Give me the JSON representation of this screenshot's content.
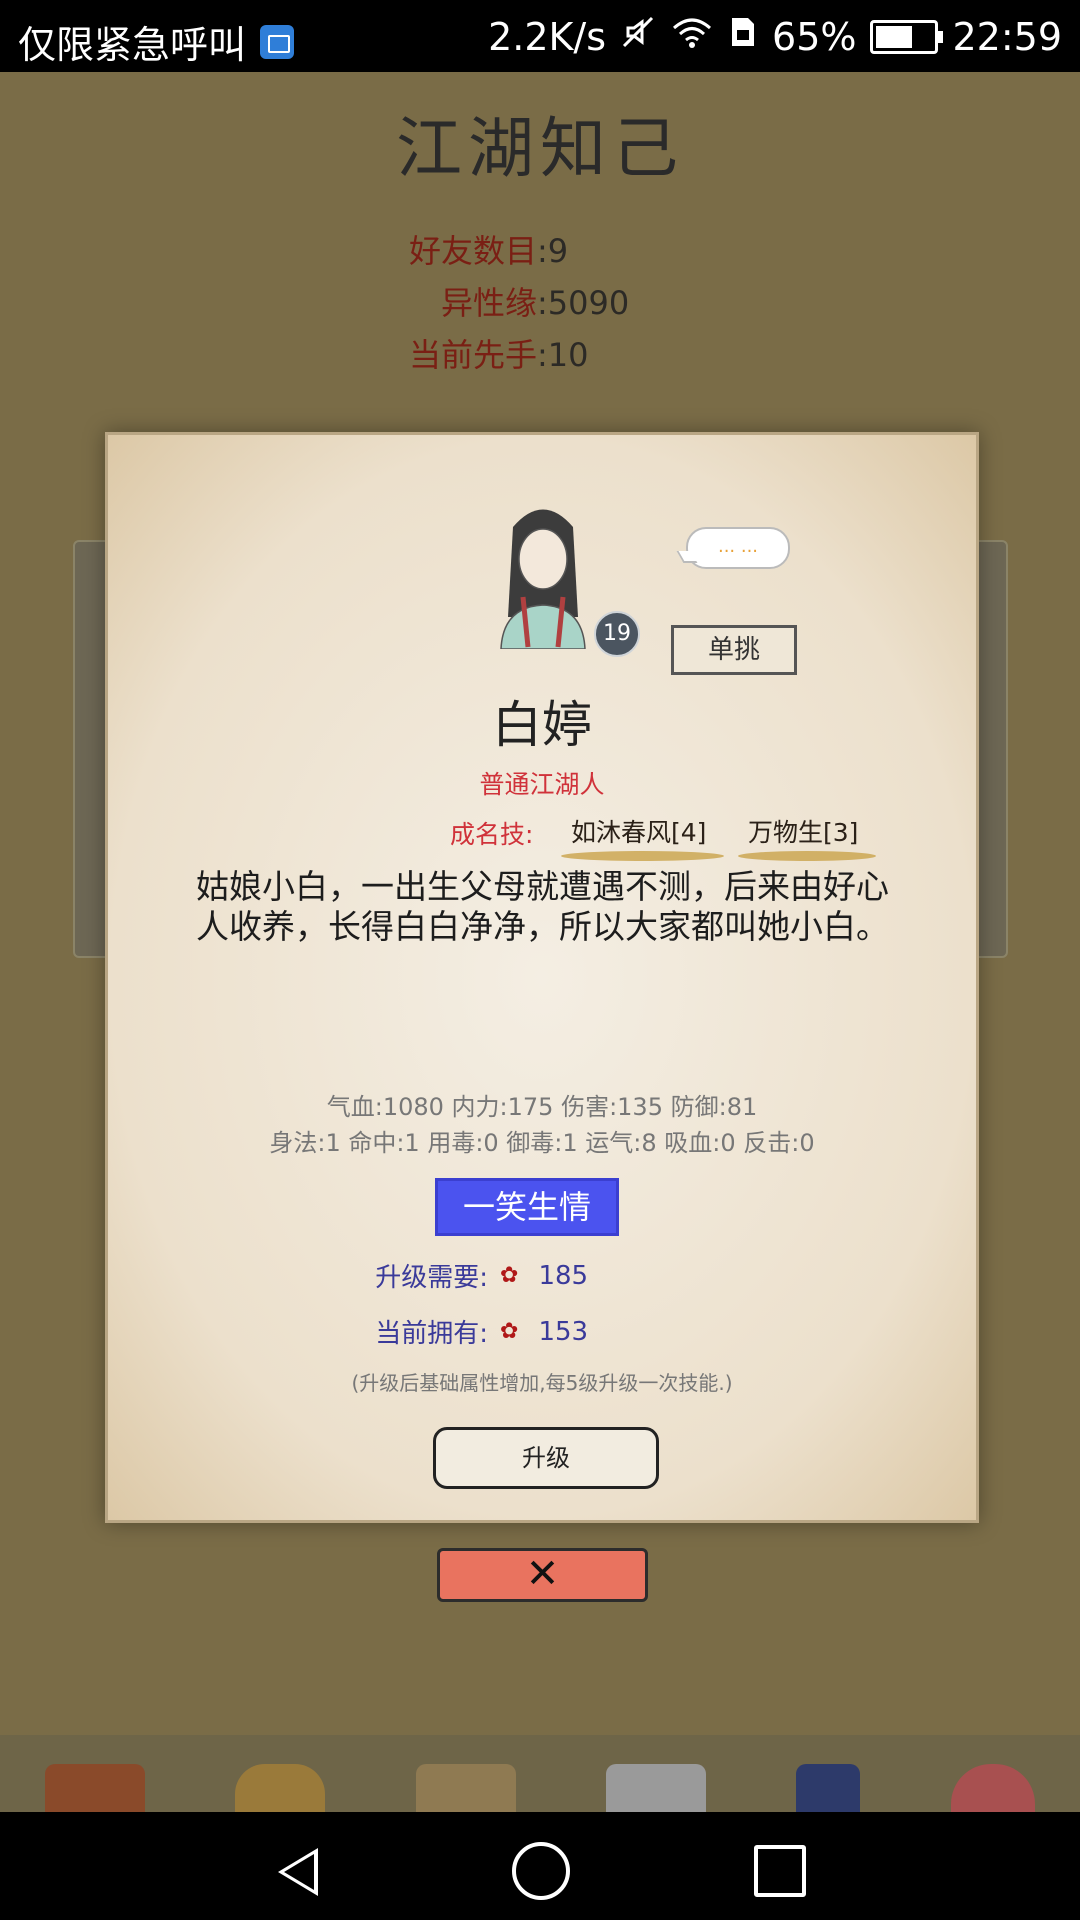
{
  "status_bar": {
    "carrier": "仅限紧急呼叫",
    "speed": "2.2K/s",
    "battery": "65%",
    "battery_level": 0.65,
    "time": "22:59"
  },
  "page": {
    "title": "江湖知己",
    "stats": [
      {
        "label": "好友数目",
        "value": ":9"
      },
      {
        "label": "异性缘",
        "value": ":5090"
      },
      {
        "label": "当前先手",
        "value": ":10"
      }
    ]
  },
  "popup": {
    "level": "19",
    "bubble": "... ...",
    "duel_label": "单挑",
    "name": "白婷",
    "rank": "普通江湖人",
    "skills_label": "成名技:",
    "skills": [
      "如沐春风[4]",
      "万物生[3]"
    ],
    "description": "姑娘小白，一出生父母就遭遇不测，后来由好心人收养，长得白白净净，所以大家都叫她小白。",
    "attrs_line1": "气血:1080  内力:175  伤害:135  防御:81",
    "attrs_line2": "身法:1  命中:1  用毒:0  御毒:1  运气:8  吸血:0  反击:0",
    "special_skill": "一笑生情",
    "upgrade_need_label": "升级需要:",
    "upgrade_need_value": "185",
    "owned_label": "当前拥有:",
    "owned_value": "153",
    "note": "(升级后基础属性增加,每5级升级一次技能.)",
    "upgrade_label": "升级",
    "close_label": "✕"
  }
}
